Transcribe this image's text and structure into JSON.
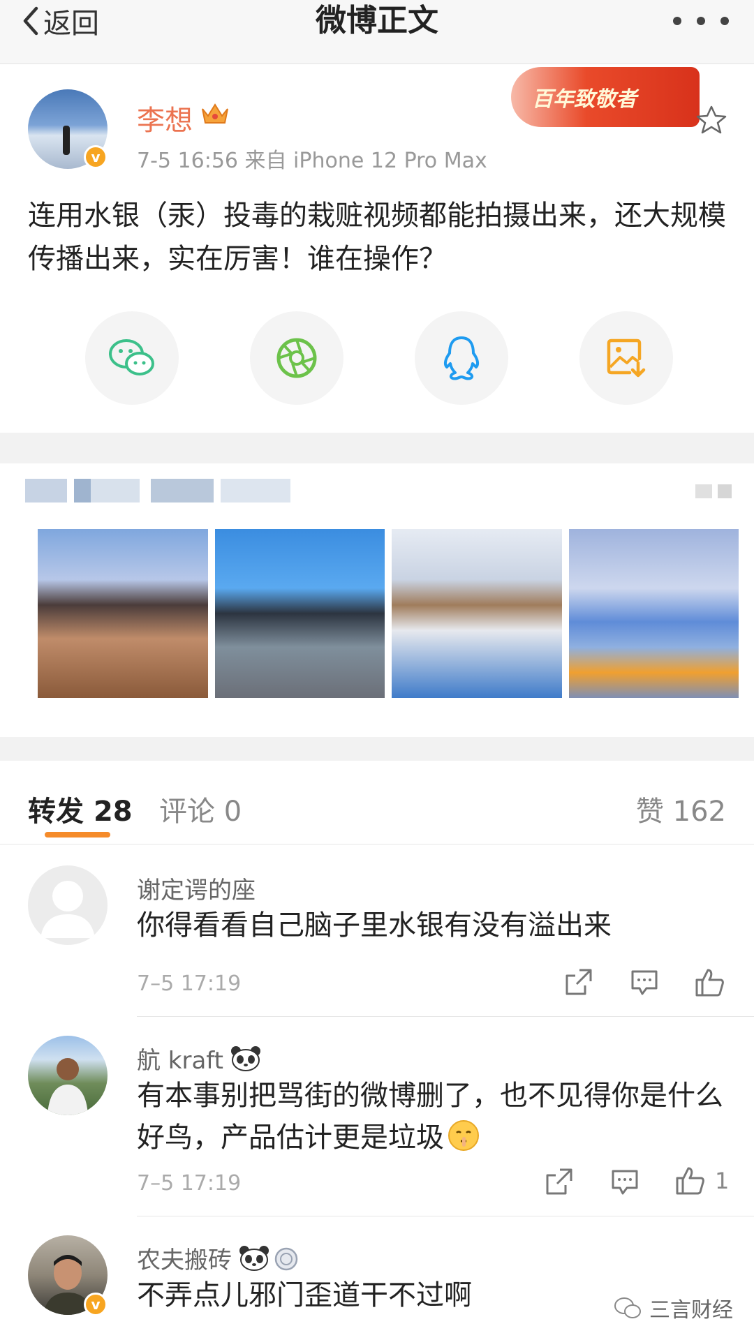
{
  "nav": {
    "back_label": "返回",
    "title": "微博正文"
  },
  "post": {
    "username": "李想",
    "badge_text": "百年致敬者",
    "meta": "7-5 16:56  来自 iPhone 12 Pro Max",
    "text": "连用水银（汞）投毒的栽赃视频都能拍摄出来，还大规模传播出来，实在厉害！谁在操作？",
    "verified_mark": "v"
  },
  "share": [
    "wechat-icon",
    "moments-icon",
    "qq-icon",
    "save-image-icon"
  ],
  "tabs": {
    "repost_label": "转发",
    "repost_count": "28",
    "comment_label": "评论",
    "comment_count": "0",
    "like_label": "赞",
    "like_count": "162"
  },
  "comments": [
    {
      "name": "谢定谔的座",
      "text": "你得看看自己脑子里水银有没有溢出来",
      "time": "7–5 17:19",
      "likes": ""
    },
    {
      "name": "航 kraft",
      "text": "有本事别把骂街的微博删了，也不见得你是什么好鸟，产品估计更是垃圾",
      "time": "7–5 17:19",
      "likes": "1"
    },
    {
      "name": "农夫搬砖",
      "text": "不弄点儿邪门歪道干不过啊",
      "time": "",
      "likes": ""
    }
  ],
  "watermark": "三言财经",
  "colors": {
    "accent": "#f58b2a",
    "username": "#eb7350",
    "verified": "#f7a521"
  }
}
